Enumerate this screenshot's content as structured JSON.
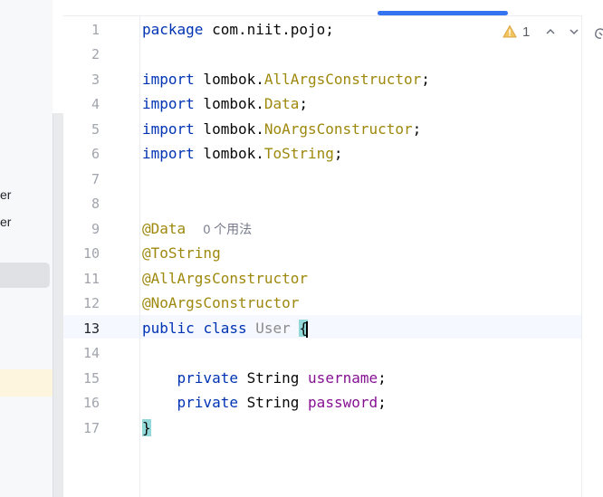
{
  "project_panel": {
    "items": [
      {
        "label": "er"
      },
      {
        "label": "er"
      }
    ]
  },
  "inspection": {
    "warning_count": "1"
  },
  "editor": {
    "current_line": 13,
    "line_numbers": [
      "1",
      "2",
      "3",
      "4",
      "5",
      "6",
      "7",
      "8",
      "9",
      "10",
      "11",
      "12",
      "13",
      "14",
      "15",
      "16",
      "17"
    ],
    "code": {
      "l1_kw": "package",
      "l1_rest": " com.niit.pojo;",
      "import_kw": "import",
      "l3_pkg": " lombok.",
      "l3_cls": "AllArgsConstructor",
      "l4_pkg": " lombok.",
      "l4_cls": "Data",
      "l5_pkg": " lombok.",
      "l5_cls": "NoArgsConstructor",
      "l6_pkg": " lombok.",
      "l6_cls": "ToString",
      "semicolon": ";",
      "l9_anno": "@Data",
      "l9_hint": "0 个用法",
      "l10_anno": "@ToString",
      "l11_anno": "@AllArgsConstructor",
      "l12_anno": "@NoArgsConstructor",
      "l13_kw1": "public",
      "l13_kw2": "class",
      "l13_cls": "User",
      "open_brace": "{",
      "private_kw": "private",
      "type_string": "String",
      "field_username": "username",
      "field_password": "password",
      "close_brace": "}"
    }
  }
}
